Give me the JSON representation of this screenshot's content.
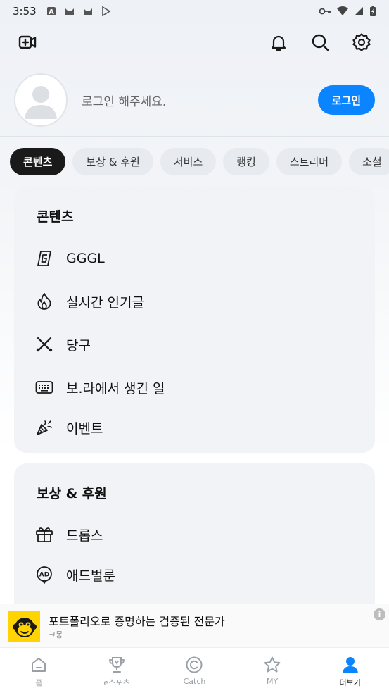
{
  "statusbar": {
    "time": "3:53"
  },
  "colors": {
    "accent": "#0a84ff",
    "active_chip": "#1a1a1a",
    "active_tab": "#0a84ff",
    "ad_logo": "#ffd400"
  },
  "topbar": {
    "icons": [
      "video-add-icon",
      "bell-icon",
      "search-icon",
      "gear-icon"
    ]
  },
  "profile": {
    "login_prompt": "로그인 해주세요.",
    "login_button": "로그인"
  },
  "chips": [
    "콘텐츠",
    "보상 & 후원",
    "서비스",
    "랭킹",
    "스트리머",
    "소셜"
  ],
  "sections": [
    {
      "title": "콘텐츠",
      "items": [
        {
          "label": "GGGL",
          "icon": "gggl-logo-icon"
        },
        {
          "label": "실시간 인기글",
          "icon": "flame-icon"
        },
        {
          "label": "당구",
          "icon": "billiard-cue-icon"
        },
        {
          "label": "보.라에서 생긴 일",
          "icon": "keyboard-icon"
        },
        {
          "label": "이벤트",
          "icon": "party-popper-icon"
        }
      ]
    },
    {
      "title": "보상 & 후원",
      "items": [
        {
          "label": "드롭스",
          "icon": "gift-icon"
        },
        {
          "label": "애드벌룬",
          "icon": "ad-balloon-icon"
        }
      ]
    }
  ],
  "ad": {
    "title": "포트폴리오로 증명하는 검증된 전문가",
    "advertiser": "크몽",
    "info": "i"
  },
  "bottom_nav": [
    {
      "label": "홈",
      "icon": "home-icon"
    },
    {
      "label": "e스포츠",
      "icon": "trophy-icon"
    },
    {
      "label": "Catch",
      "icon": "catch-icon"
    },
    {
      "label": "MY",
      "icon": "star-icon"
    },
    {
      "label": "더보기",
      "icon": "person-icon",
      "active": true
    }
  ]
}
